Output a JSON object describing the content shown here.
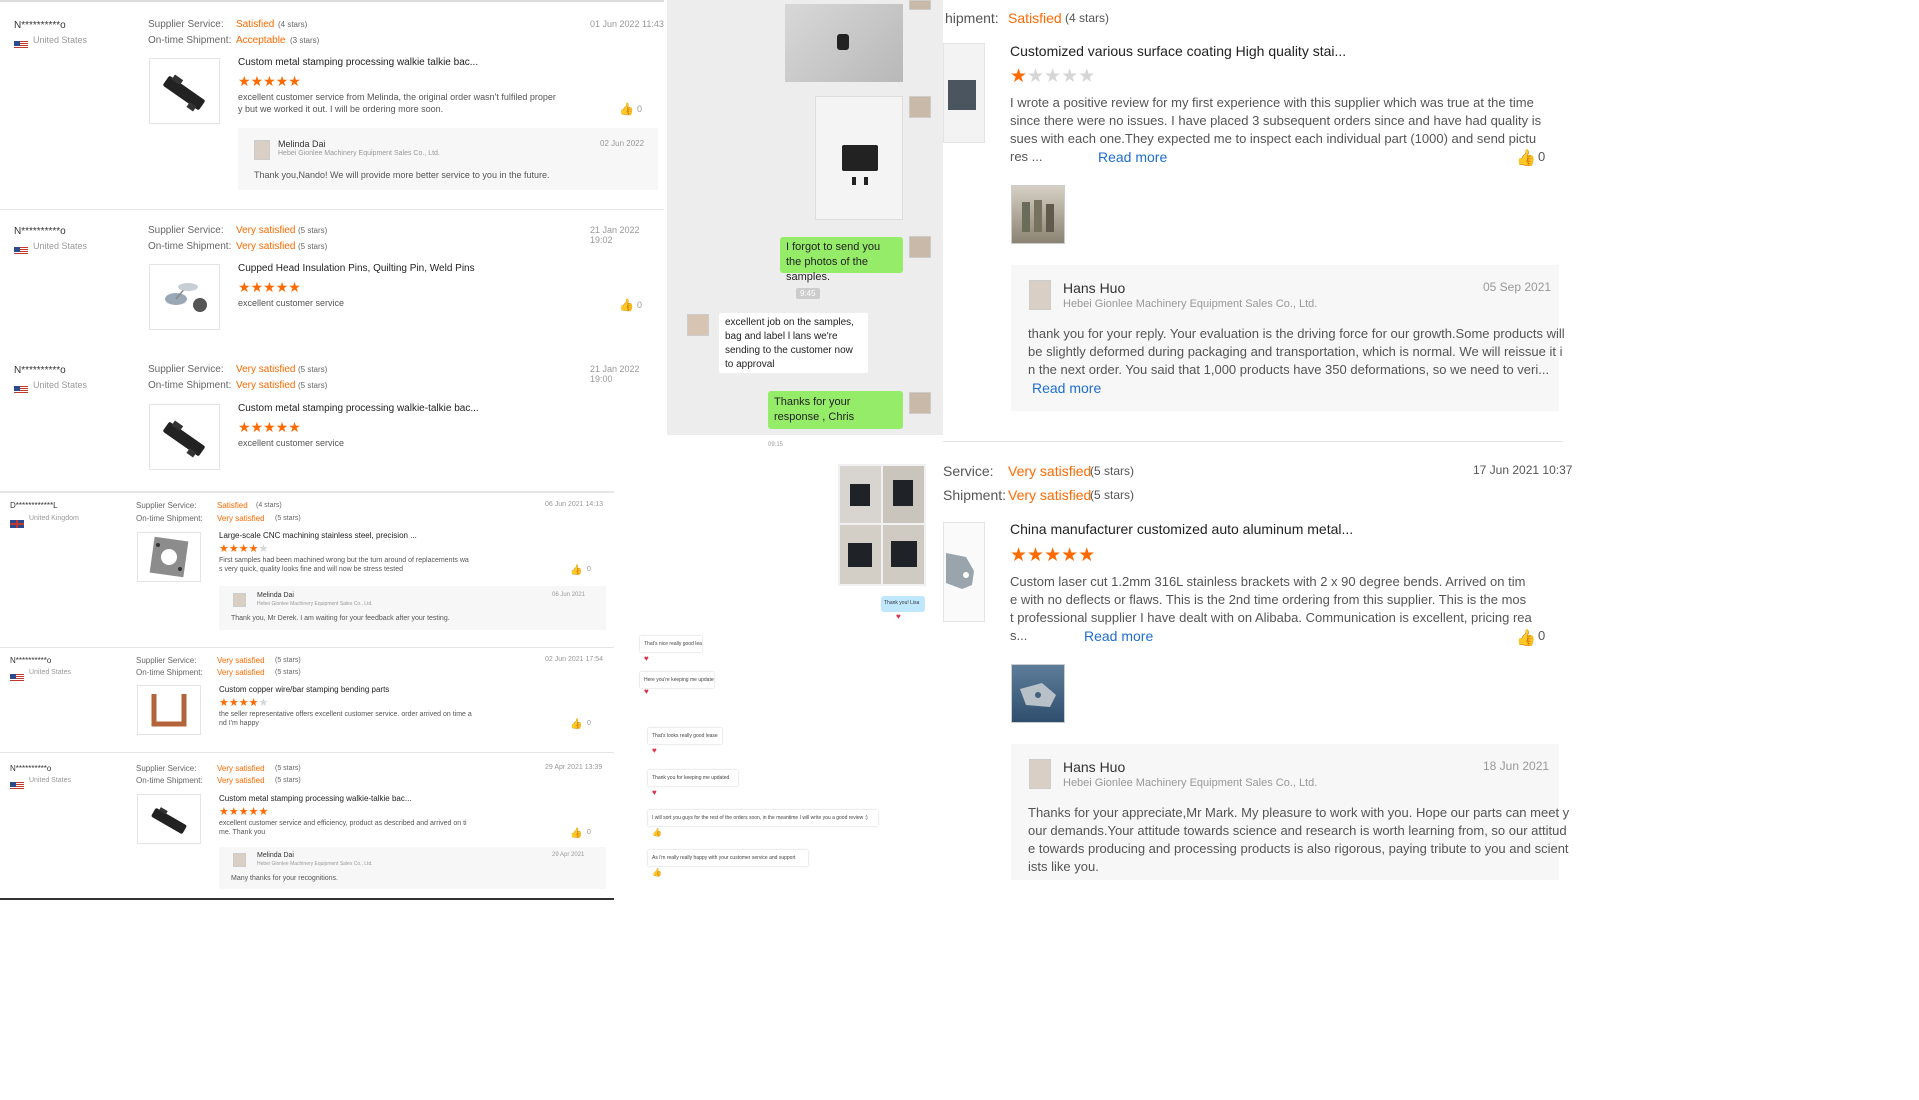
{
  "colors": {
    "orange": "#ff6a00",
    "wechat_green": "#95ec69",
    "link_blue": "#1e6ecf",
    "heart_red": "#e0304a"
  },
  "p1": {
    "reviews": [
      {
        "name": "N**********o",
        "country": "United States",
        "date": "01 Jun 2022 11:43",
        "service_label": "Supplier Service:",
        "service_value": "Satisfied",
        "service_stars": "(4 stars)",
        "ship_label": "On-time Shipment:",
        "ship_value": "Acceptable",
        "ship_stars": "(3 stars)",
        "product": "Custom metal stamping processing walkie talkie bac...",
        "rating": 5,
        "text1": "excellent customer service from Melinda, the original order wasn't fulfiled proper",
        "text2": "y but we worked it out. I will be ordering more soon.",
        "likes": "0",
        "reply_name": "Melinda Dai",
        "reply_company": "Hebei Gionlee Machinery Equipment Sales Co., Ltd.",
        "reply_date": "02 Jun 2022",
        "reply_text": "Thank you,Nando! We will provide more better service to you in the future."
      },
      {
        "name": "N**********o",
        "country": "United States",
        "date": "21 Jan 2022 19:02",
        "service_label": "Supplier Service:",
        "service_value": "Very satisfied",
        "service_stars": "(5 stars)",
        "ship_label": "On-time Shipment:",
        "ship_value": "Very satisfied",
        "ship_stars": "(5 stars)",
        "product": "Cupped Head Insulation Pins, Quilting Pin, Weld Pins",
        "rating": 5,
        "text1": "excellent customer service",
        "likes": "0"
      },
      {
        "name": "N**********o",
        "country": "United States",
        "date": "21 Jan 2022 19:00",
        "service_label": "Supplier Service:",
        "service_value": "Very satisfied",
        "service_stars": "(5 stars)",
        "ship_label": "On-time Shipment:",
        "ship_value": "Very satisfied",
        "ship_stars": "(5 stars)",
        "product": "Custom metal stamping processing walkie-talkie bac...",
        "rating": 5,
        "text1": "excellent customer service"
      }
    ]
  },
  "p2": {
    "bubbles": [
      {
        "text": "I forgot to send you the photos of the samples."
      },
      {
        "time": "9:45"
      },
      {
        "text": "excellent job on the samples, bag and label l lans we're sending to the customer now to approval"
      },
      {
        "text": "Thanks for your response , Chris"
      }
    ]
  },
  "p3": {
    "top": {
      "ship_label": "hipment:",
      "ship_value": "Satisfied",
      "ship_stars": "(4 stars)",
      "product": "Customized various surface coating High quality stai...",
      "rating": 1,
      "l1": "I wrote a positive review for my first experience with this supplier which was true at the time",
      "l2": "since there were no issues. I have placed 3 subsequent orders since and have had quality is",
      "l3": "sues with each one.They expected me to inspect each individual part (1000) and send pictu",
      "l4": "res ...",
      "readmore": "Read more",
      "likes": "0",
      "reply_name": "Hans Huo",
      "reply_company": "Hebei Gionlee Machinery Equipment Sales Co., Ltd.",
      "reply_date": "05 Sep 2021",
      "r1": "thank you for your reply. Your evaluation is the driving force for our growth.Some products will",
      "r2": "be slightly deformed during packaging and transportation, which is normal. We will reissue it i",
      "r3": "n the next order. You said that 1,000 products have 350 deformations, so we need to veri...",
      "r_readmore": "Read more"
    },
    "bottom": {
      "service_label": "Service:",
      "service_value": "Very satisfied",
      "service_stars": "(5 stars)",
      "ship_label": "Shipment:",
      "ship_value": "Very satisfied",
      "ship_stars": "(5 stars)",
      "date": "17 Jun 2021 10:37",
      "product": "China manufacturer customized auto aluminum metal...",
      "rating": 5,
      "l1": "Custom laser cut 1.2mm 316L stainless brackets with 2 x 90 degree bends.   Arrived on tim",
      "l2": "e with no deflects or flaws.  This is the 2nd time ordering from this supplier.  This is the mos",
      "l3": "t professional supplier I have dealt with on Alibaba.  Communication is excellent, pricing rea",
      "l4": "s...",
      "readmore": "Read more",
      "likes": "0",
      "reply_name": "Hans Huo",
      "reply_company": "Hebei Gionlee Machinery Equipment Sales Co., Ltd.",
      "reply_date": "18 Jun 2021",
      "r1": "Thanks for your appreciate,Mr Mark. My pleasure to work with you. Hope our parts can meet y",
      "r2": "our demands.Your attitude towards science and research is worth learning from, so our attitud",
      "r3": "e towards producing and processing products is also rigorous, paying tribute to you and scient",
      "r4": "ists like you."
    }
  },
  "p4": {
    "reviews": [
      {
        "name": "D************L",
        "country": "United Kingdom",
        "date": "06 Jun 2021 14:13",
        "service_label": "Supplier Service:",
        "service_value": "Satisfied",
        "service_stars": "(4 stars)",
        "ship_label": "On-time Shipment:",
        "ship_value": "Very satisfied",
        "ship_stars": "(5 stars)",
        "product": "Large-scale CNC machining stainless steel, precision ...",
        "rating": 4,
        "text1": "First samples had been machined wrong but the turn around of replacements wa",
        "text2": "s very quick, quality looks fine and will now be stress tested",
        "likes": "0",
        "reply_name": "Melinda Dai",
        "reply_company": "Hebei Gionlee Machinery Equipment Sales Co., Ltd.",
        "reply_date": "06 Jun 2021",
        "reply_text": "Thank you, Mr Derek. I am waiting for your feedback after your testing."
      },
      {
        "name": "N**********o",
        "country": "United States",
        "date": "02 Jun 2021 17:54",
        "service_label": "Supplier Service:",
        "service_value": "Very satisfied",
        "service_stars": "(5 stars)",
        "ship_label": "On-time Shipment:",
        "ship_value": "Very satisfied",
        "ship_stars": "(5 stars)",
        "product": "Custom copper wire/bar stamping bending parts",
        "rating": 4,
        "text1": "the seller representative offers excellent customer service. order arrived on time a",
        "text2": "nd I'm happy",
        "likes": "0"
      },
      {
        "name": "N**********o",
        "country": "United States",
        "date": "29 Apr 2021 13:39",
        "service_label": "Supplier Service:",
        "service_value": "Very satisfied",
        "service_stars": "(5 stars)",
        "ship_label": "On-time Shipment:",
        "ship_value": "Very satisfied",
        "ship_stars": "(5 stars)",
        "product": "Custom metal stamping processing walkie-talkie bac...",
        "rating": 5,
        "text1": "excellent customer service and efficiency, product as described and arrived on ti",
        "text2": "me. Thank you",
        "likes": "0",
        "reply_name": "Melinda Dai",
        "reply_company": "Hebei Gionlee Machinery Equipment Sales Co., Ltd.",
        "reply_date": "29 Apr 2021",
        "reply_text": "Many thanks for your recognitions."
      }
    ]
  },
  "p5": {
    "top_time": "09:15",
    "sent_text": "Thank you! Lisa",
    "msgs": [
      {
        "text": "That's nice really good lease"
      },
      {
        "text": "Here you're keeping me updated"
      },
      {
        "text": "That's looks really good lease"
      },
      {
        "text": "Thank you for keeping me updated"
      },
      {
        "text": "I will sort you guys for the rest of the orders soon, in the meantime I will write you a good review :)"
      },
      {
        "text": "As i'm really really happy with your customer service and support"
      }
    ]
  }
}
